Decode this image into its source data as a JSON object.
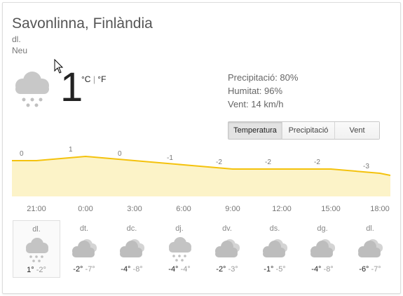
{
  "location": "Savonlinna, Finlàndia",
  "day": "dl.",
  "condition": "Neu",
  "current": {
    "temp": "1",
    "unit_c": "°C",
    "unit_sep": "|",
    "unit_f": "°F",
    "icon": "snow-cloud-icon"
  },
  "details": {
    "precip": "Precipitació: 80%",
    "humidity": "Humitat: 96%",
    "wind": "Vent: 14 km/h"
  },
  "tabs": [
    {
      "label": "Temperatura",
      "active": true
    },
    {
      "label": "Precipitació",
      "active": false
    },
    {
      "label": "Vent",
      "active": false
    }
  ],
  "chart_data": {
    "type": "area",
    "x": [
      "21:00",
      "0:00",
      "3:00",
      "6:00",
      "9:00",
      "12:00",
      "15:00",
      "18:00"
    ],
    "series": [
      {
        "values": [
          0,
          1,
          0,
          -1,
          -2,
          -2,
          -2,
          -3
        ]
      }
    ],
    "data_labels": [
      "0",
      "1",
      "0",
      "-1",
      "-2",
      "-2",
      "-2",
      "-3"
    ],
    "line_color": "#f4c20d",
    "fill_color": "#fcf3c8"
  },
  "forecast": [
    {
      "day": "dl.",
      "icon": "snow-icon",
      "hi": "1°",
      "lo": "-2°"
    },
    {
      "day": "dt.",
      "icon": "cloud-icon",
      "hi": "-2°",
      "lo": "-7°"
    },
    {
      "day": "dc.",
      "icon": "cloud-icon",
      "hi": "-4°",
      "lo": "-8°"
    },
    {
      "day": "dj.",
      "icon": "snow-icon",
      "hi": "-4°",
      "lo": "-4°"
    },
    {
      "day": "dv.",
      "icon": "cloud-icon",
      "hi": "-2°",
      "lo": "-3°"
    },
    {
      "day": "ds.",
      "icon": "cloud-icon",
      "hi": "-1°",
      "lo": "-5°"
    },
    {
      "day": "dg.",
      "icon": "cloud-icon",
      "hi": "-4°",
      "lo": "-8°"
    },
    {
      "day": "dl.",
      "icon": "cloud-icon",
      "hi": "-6°",
      "lo": "-7°"
    }
  ]
}
